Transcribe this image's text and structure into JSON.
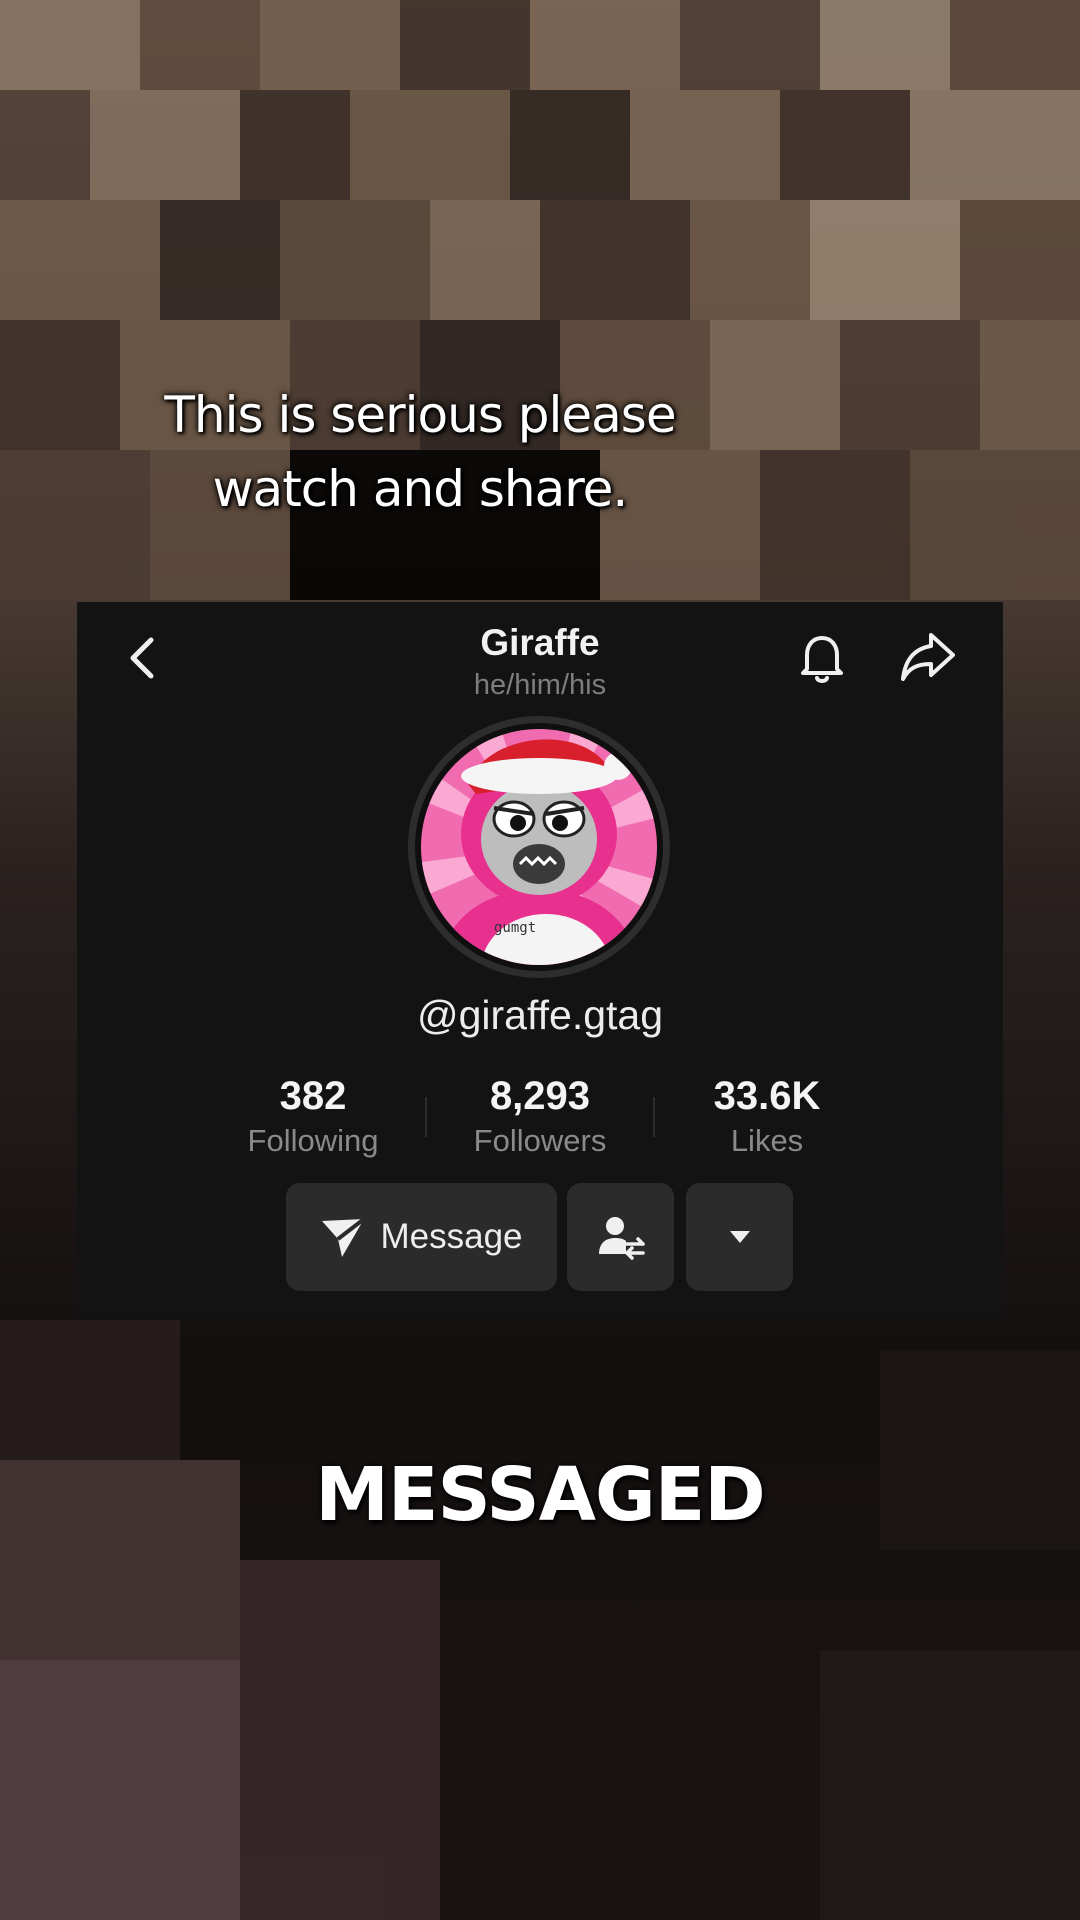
{
  "video": {
    "caption_lines": [
      "This is serious please",
      "watch and share."
    ],
    "overlay_text": "MESSAGED"
  },
  "profile": {
    "name": "Giraffe",
    "pronouns": "he/him/his",
    "handle": "@giraffe.gtag",
    "avatar_text": "gumgt",
    "stats": [
      {
        "value": "382",
        "label": "Following"
      },
      {
        "value": "8,293",
        "label": "Followers"
      },
      {
        "value": "33.6K",
        "label": "Likes"
      }
    ],
    "buttons": {
      "message_label": "Message"
    },
    "icons": {
      "back": "chevron-left-icon",
      "notifications": "bell-icon",
      "share": "share-arrow-icon",
      "message": "send-icon",
      "friends": "user-swap-icon",
      "more": "caret-down-icon"
    }
  },
  "colors": {
    "card_background": "#131313",
    "button_background": "#2b2b2b",
    "avatar_pink": "#f04ba0"
  }
}
